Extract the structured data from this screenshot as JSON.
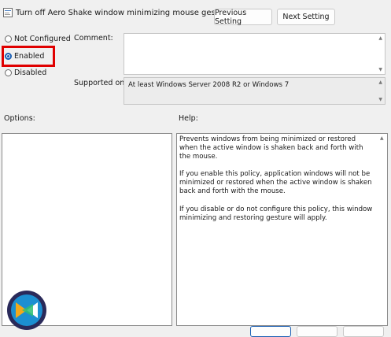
{
  "window": {
    "title": "Turn off Aero Shake window minimizing mouse gesture",
    "previous_label": "Previous Setting",
    "next_label": "Next Setting"
  },
  "state": {
    "options": [
      {
        "label": "Not Configured",
        "checked": false
      },
      {
        "label": "Enabled",
        "checked": true
      },
      {
        "label": "Disabled",
        "checked": false
      }
    ]
  },
  "comment": {
    "label": "Comment:",
    "value": ""
  },
  "supported": {
    "label": "Supported on:",
    "value": "At least Windows Server 2008 R2 or Windows 7"
  },
  "options_panel": {
    "label": "Options:"
  },
  "help": {
    "label": "Help:",
    "paragraphs": [
      "Prevents windows from being minimized or restored when the active window is shaken back and forth with the mouse.",
      "If you enable this policy, application windows will not be minimized or restored when the active window is shaken back and forth with the mouse.",
      "If you disable or do not configure this policy, this window minimizing and restoring gesture will apply."
    ]
  },
  "colors": {
    "highlight": "#e00000",
    "radio_selected": "#1a5fb4"
  },
  "icons": {
    "title": "policy-setting-icon",
    "logo": "brand-logo-icon"
  }
}
